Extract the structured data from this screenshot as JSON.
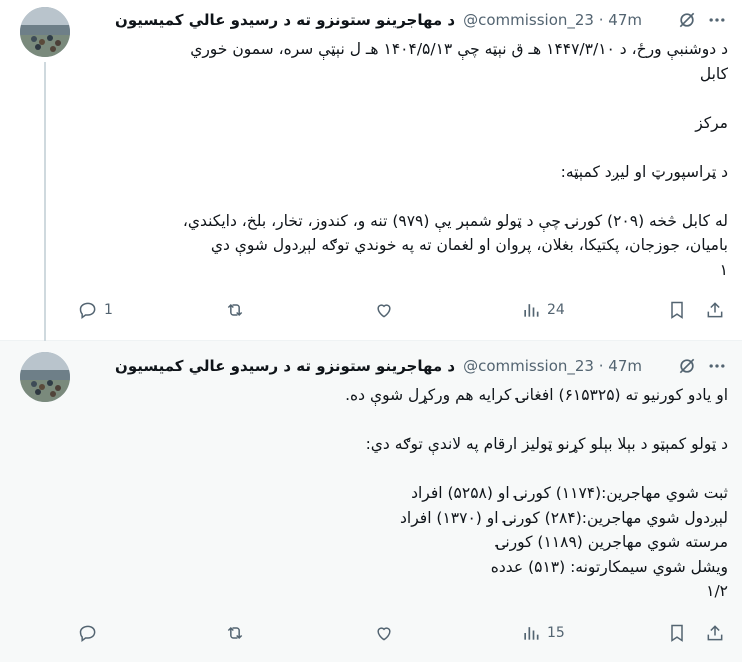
{
  "tweets": [
    {
      "author_name": "د مهاجرینو ستونزو ته د رسیدو عالي کمیسیون",
      "handle": "@commission_23",
      "time": "47m",
      "text": "د دوشنبې ورځ، د ۱۴۴۷/۳/۱۰ هـ ق نېټه چې ۱۴۰۴/۵/۱۳ هـ ل نېټې سره، سمون خوري\nکابل\n\nمرکز\n\nد ټراسپورټ او لیږد کمېټه:\n\nله کابل څخه (۲۰۹) کورنۍ چې د ټولو شمېر یې (۹۷۹) تنه و، کندوز، تخار، بلخ، دایکندي،\nبامیان، جوزجان، پکتیکا، بغلان، پروان او لغمان ته په خوندي توګه لېږدول شوې دي\n۱",
      "replies": "1",
      "reposts": "",
      "likes": "",
      "views": "24"
    },
    {
      "author_name": "د مهاجرینو ستونزو ته د رسیدو عالي کمیسیون",
      "handle": "@commission_23",
      "time": "47m",
      "text": "او یادو کورنیو ته (۶۱۵۳۲۵) افغانۍ کرایه هم ورکړل شوې ده.\n\nد ټولو کمېټو د بېلا بېلو کړنو ټولیز ارقام په لاندې توګه دي:\n\nثبت شوي مهاجرین:(۱۱۷۴) کورنۍ او (۵۲۵۸) افراد\nلېږدول شوي مهاجرین:(۲۸۴) کورنۍ او (۱۳۷۰) افراد\nمرسته شوي مهاجرین (۱۱۸۹) کورنۍ\nویشل شوي سیمکارتونه: (۵۱۳) عدده\n۱/۲",
      "replies": "",
      "reposts": "",
      "likes": "",
      "views": "15"
    }
  ],
  "icons": {
    "grok": "grok-icon",
    "more": "more-icon",
    "reply": "reply-icon",
    "repost": "repost-icon",
    "like": "like-icon",
    "views": "views-icon",
    "bookmark": "bookmark-icon",
    "share": "share-icon"
  },
  "colors": {
    "text": "#0f1419",
    "secondary": "#536471",
    "thread_line": "#cfd9de",
    "selected_bg": "#f7f9f9"
  }
}
